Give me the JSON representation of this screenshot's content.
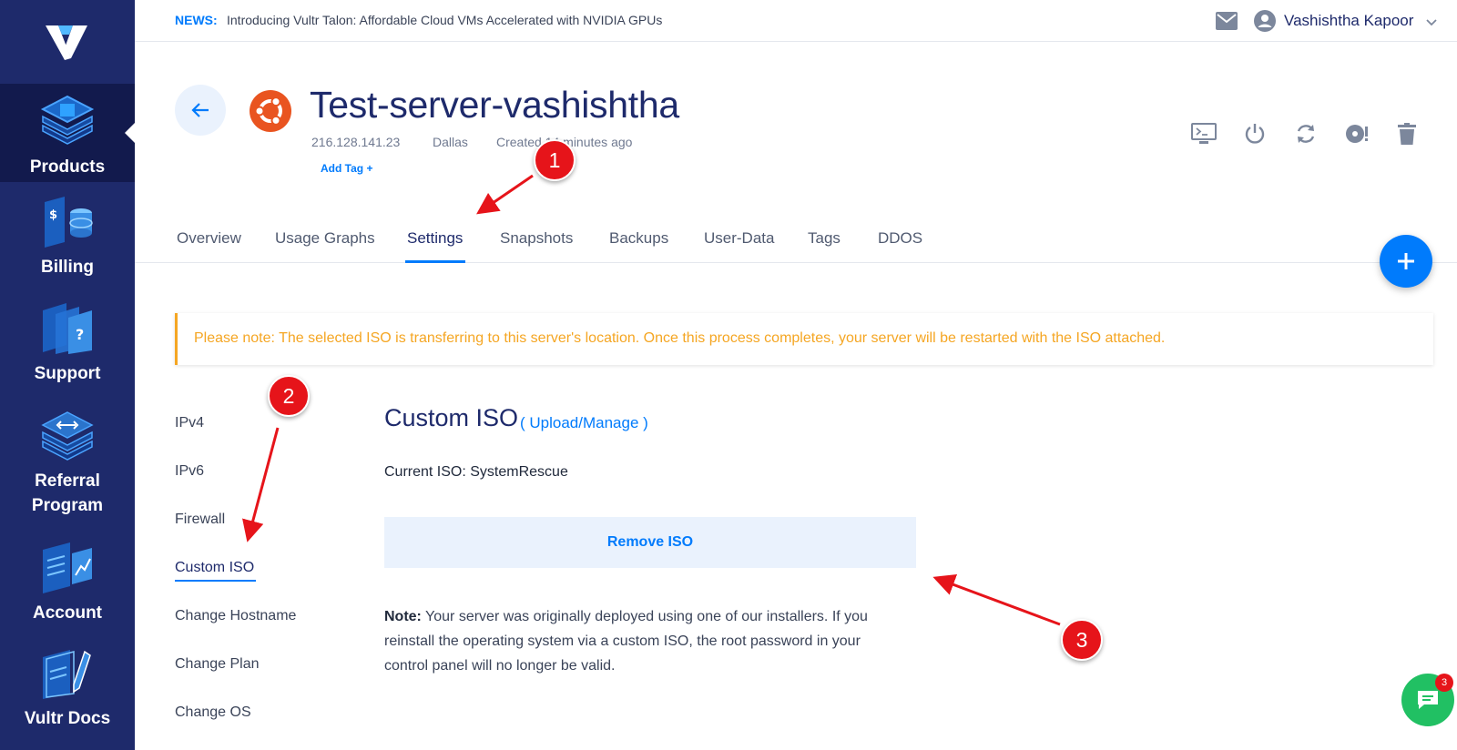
{
  "sidebar": {
    "items": [
      {
        "label": "Products",
        "icon": "products-stack-icon",
        "active": true
      },
      {
        "label": "Billing",
        "icon": "billing-coins-icon"
      },
      {
        "label": "Support",
        "icon": "support-question-icon"
      },
      {
        "label": "Referral Program",
        "icon": "referral-arrows-icon"
      },
      {
        "label": "Account",
        "icon": "account-chart-icon"
      },
      {
        "label": "Vultr Docs",
        "icon": "docs-pencil-icon"
      }
    ]
  },
  "topbar": {
    "news_label": "NEWS:",
    "news_text": "Introducing Vultr Talon: Affordable Cloud VMs Accelerated with NVIDIA GPUs",
    "user_name": "Vashishtha Kapoor"
  },
  "server": {
    "name": "Test-server-vashishtha",
    "ip": "216.128.141.23",
    "location": "Dallas",
    "created": "Created 14 minutes ago",
    "add_tag": "Add Tag +",
    "os_icon": "ubuntu-icon"
  },
  "tabs": [
    "Overview",
    "Usage Graphs",
    "Settings",
    "Snapshots",
    "Backups",
    "User-Data",
    "Tags",
    "DDOS"
  ],
  "active_tab": "Settings",
  "notice": "Please note: The selected ISO is transferring to this server's location. Once this process completes, your server will be restarted with the ISO attached.",
  "settings_menu": [
    "IPv4",
    "IPv6",
    "Firewall",
    "Custom ISO",
    "Change Hostname",
    "Change Plan",
    "Change OS"
  ],
  "active_setting": "Custom ISO",
  "content": {
    "title": "Custom ISO",
    "upload_link": "( Upload/Manage )",
    "current_iso": "Current ISO: SystemRescue",
    "remove_button": "Remove ISO",
    "note_label": "Note:",
    "note_text": " Your server was originally deployed using one of our installers. If you reinstall the operating system via a custom ISO, the root password in your control panel will no longer be valid."
  },
  "annotations": [
    "1",
    "2",
    "3"
  ],
  "chat": {
    "count": "3"
  },
  "colors": {
    "sidebar": "#1e2a6b",
    "sidebar_active": "#121a4d",
    "accent": "#007bfc",
    "warning": "#f5a623",
    "annotation": "#e6141a",
    "chat": "#21c063"
  }
}
